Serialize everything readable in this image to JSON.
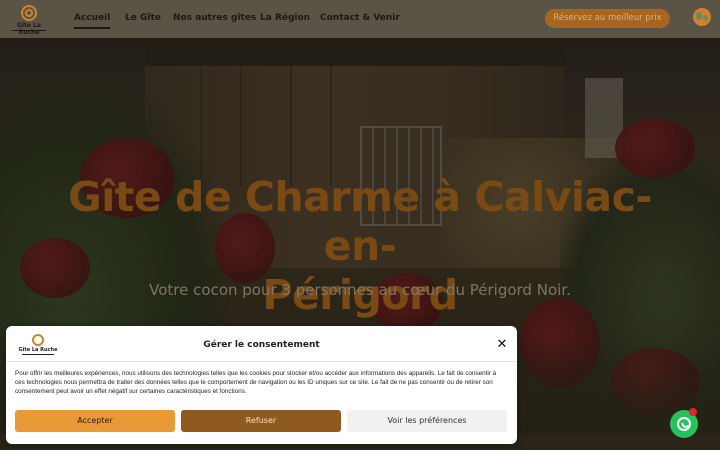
{
  "header": {
    "logo_text": "Gîte La Ruche",
    "nav": [
      "Accueil",
      "Le Gîte",
      "Nos autres gîtes",
      "La Région",
      "Contact & Venir"
    ],
    "active_nav": "Accueil",
    "cta_label": "Réservez au meilleur prix",
    "language_icon": "globe-icon"
  },
  "hero": {
    "title_line1": "Gîte de Charme à Calviac-en-",
    "title_line2": "Périgord",
    "subtitle": "Votre cocon pour 3 personnes au cœur du Périgord Noir."
  },
  "consent": {
    "logo_text": "Gîte La Ruche",
    "title": "Gérer le consentement",
    "close_label": "✕",
    "text": "Pour offrir les meilleures expériences, nous utilisons des technologies telles que les cookies pour stocker et/ou accéder aux informations des appareils. Le fait de consentir à ces technologies nous permettra de traiter des données telles que le comportement de navigation ou les ID uniques sur ce site. Le fait de ne pas consentir ou de retirer son consentement peut avoir un effet négatif sur certaines caractéristiques et fonctions.",
    "accept_label": "Accepter",
    "refuse_label": "Refuser",
    "prefs_label": "Voir les préférences"
  },
  "colors": {
    "accent": "#d2822e",
    "header_bg": "#5a5446",
    "accept_bg": "#e89a37",
    "refuse_bg": "#8f5a1e",
    "whatsapp": "#25c35c"
  },
  "chat_icon": "whatsapp-icon"
}
